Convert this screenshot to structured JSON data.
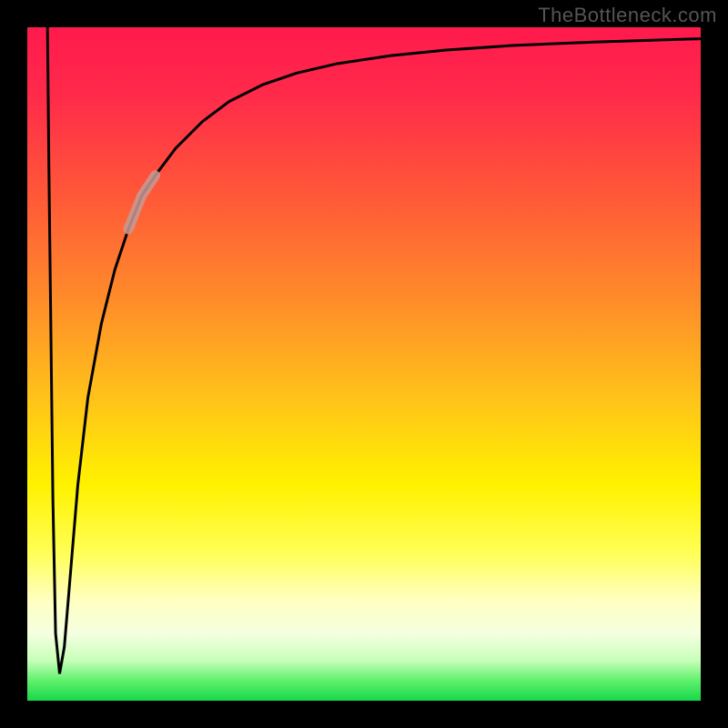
{
  "watermark": "TheBottleneck.com",
  "colors": {
    "frame_bg": "#000000",
    "curve_stroke": "#000000",
    "highlight_stroke": "#c79a95",
    "gradient_stops": [
      "#ff1a4d",
      "#ff2a4a",
      "#ff5838",
      "#ff8a2a",
      "#ffc21a",
      "#fff200",
      "#ffff55",
      "#ffffc0",
      "#f5ffe0",
      "#c8ffba",
      "#60f06c",
      "#17d84a"
    ]
  },
  "chart_data": {
    "type": "line",
    "title": "",
    "xlabel": "",
    "ylabel": "",
    "xlim": [
      0,
      100
    ],
    "ylim": [
      0,
      100
    ],
    "grid": false,
    "series": [
      {
        "name": "bottleneck-curve",
        "x": [
          3.0,
          3.2,
          3.5,
          3.8,
          4.2,
          4.8,
          5.5,
          6.5,
          7.5,
          9,
          11,
          13,
          15,
          17,
          19,
          22,
          26,
          30,
          35,
          40,
          46,
          54,
          62,
          72,
          84,
          100
        ],
        "y": [
          100,
          80,
          55,
          30,
          10,
          4,
          8,
          20,
          32,
          45,
          56,
          64,
          70,
          75,
          78,
          82,
          86,
          89,
          91.5,
          93.2,
          94.6,
          95.8,
          96.6,
          97.3,
          97.8,
          98.3
        ]
      }
    ],
    "highlight_segment": {
      "x_start": 15,
      "x_end": 19
    }
  }
}
